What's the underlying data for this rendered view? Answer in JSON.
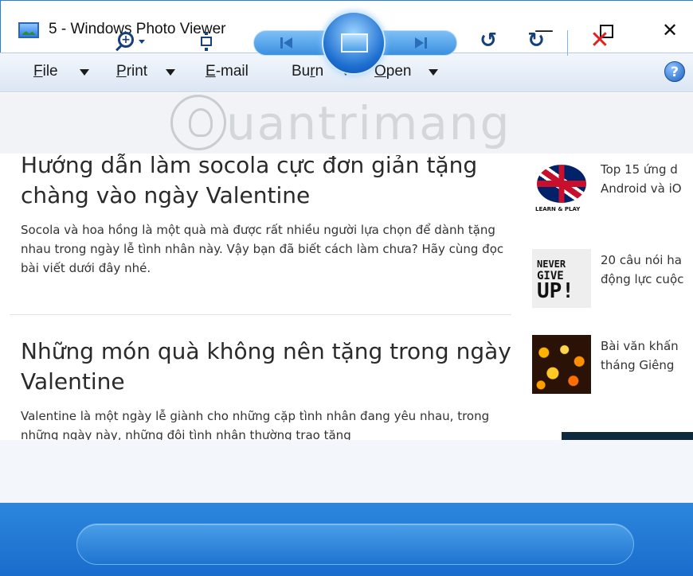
{
  "window": {
    "title": "5 - Windows Photo Viewer",
    "minimize_glyph": "—",
    "close_glyph": "✕"
  },
  "menu": {
    "items": [
      {
        "label_underlined": "F",
        "label_rest": "ile"
      },
      {
        "label_underlined": "P",
        "label_rest": "rint"
      },
      {
        "label_underlined": "E",
        "label_rest": "-mail"
      },
      {
        "label_prefix": "Bu",
        "label_underlined": "r",
        "label_rest": "n"
      },
      {
        "label_underlined": "O",
        "label_rest": "pen"
      }
    ],
    "help_label": "?"
  },
  "photo": {
    "watermark": "uantrimang",
    "articles": [
      {
        "title": "Hướng dẫn làm socola cực đơn giản tặng chàng vào ngày Valentine",
        "body": "Socola và hoa hồng là một quà mà được rất nhiều người lựa chọn để dành tặng nhau trong ngày lễ tình nhân này. Vậy bạn đã biết cách làm chưa? Hãy cùng đọc bài viết dưới đây nhé."
      },
      {
        "title": "Những món quà không nên tặng trong ngày Valentine",
        "body": "Valentine là một ngày lễ giành cho những cặp tình nhân đang yêu nhau, trong những ngày này, những đôi tình nhân thường trao tặng"
      }
    ],
    "sidebar": [
      {
        "line1": "Top 15 ứng d",
        "line2": "Android và iO",
        "thumb_caption": "LEARN & PLAY"
      },
      {
        "line1": "20 câu nói ha",
        "line2": "động lực cuộc",
        "thumb_lines": [
          "NEVER",
          "GIVE",
          "UP!"
        ]
      },
      {
        "line1": "Bài văn khấn",
        "line2": "tháng Giêng"
      }
    ]
  },
  "controls": {
    "rotate_left_glyph": "↺",
    "rotate_right_glyph": "↻",
    "delete_glyph": "✕",
    "zoom_glyph": "+",
    "accent": "#1f74cf",
    "delete_color": "#e02020"
  }
}
